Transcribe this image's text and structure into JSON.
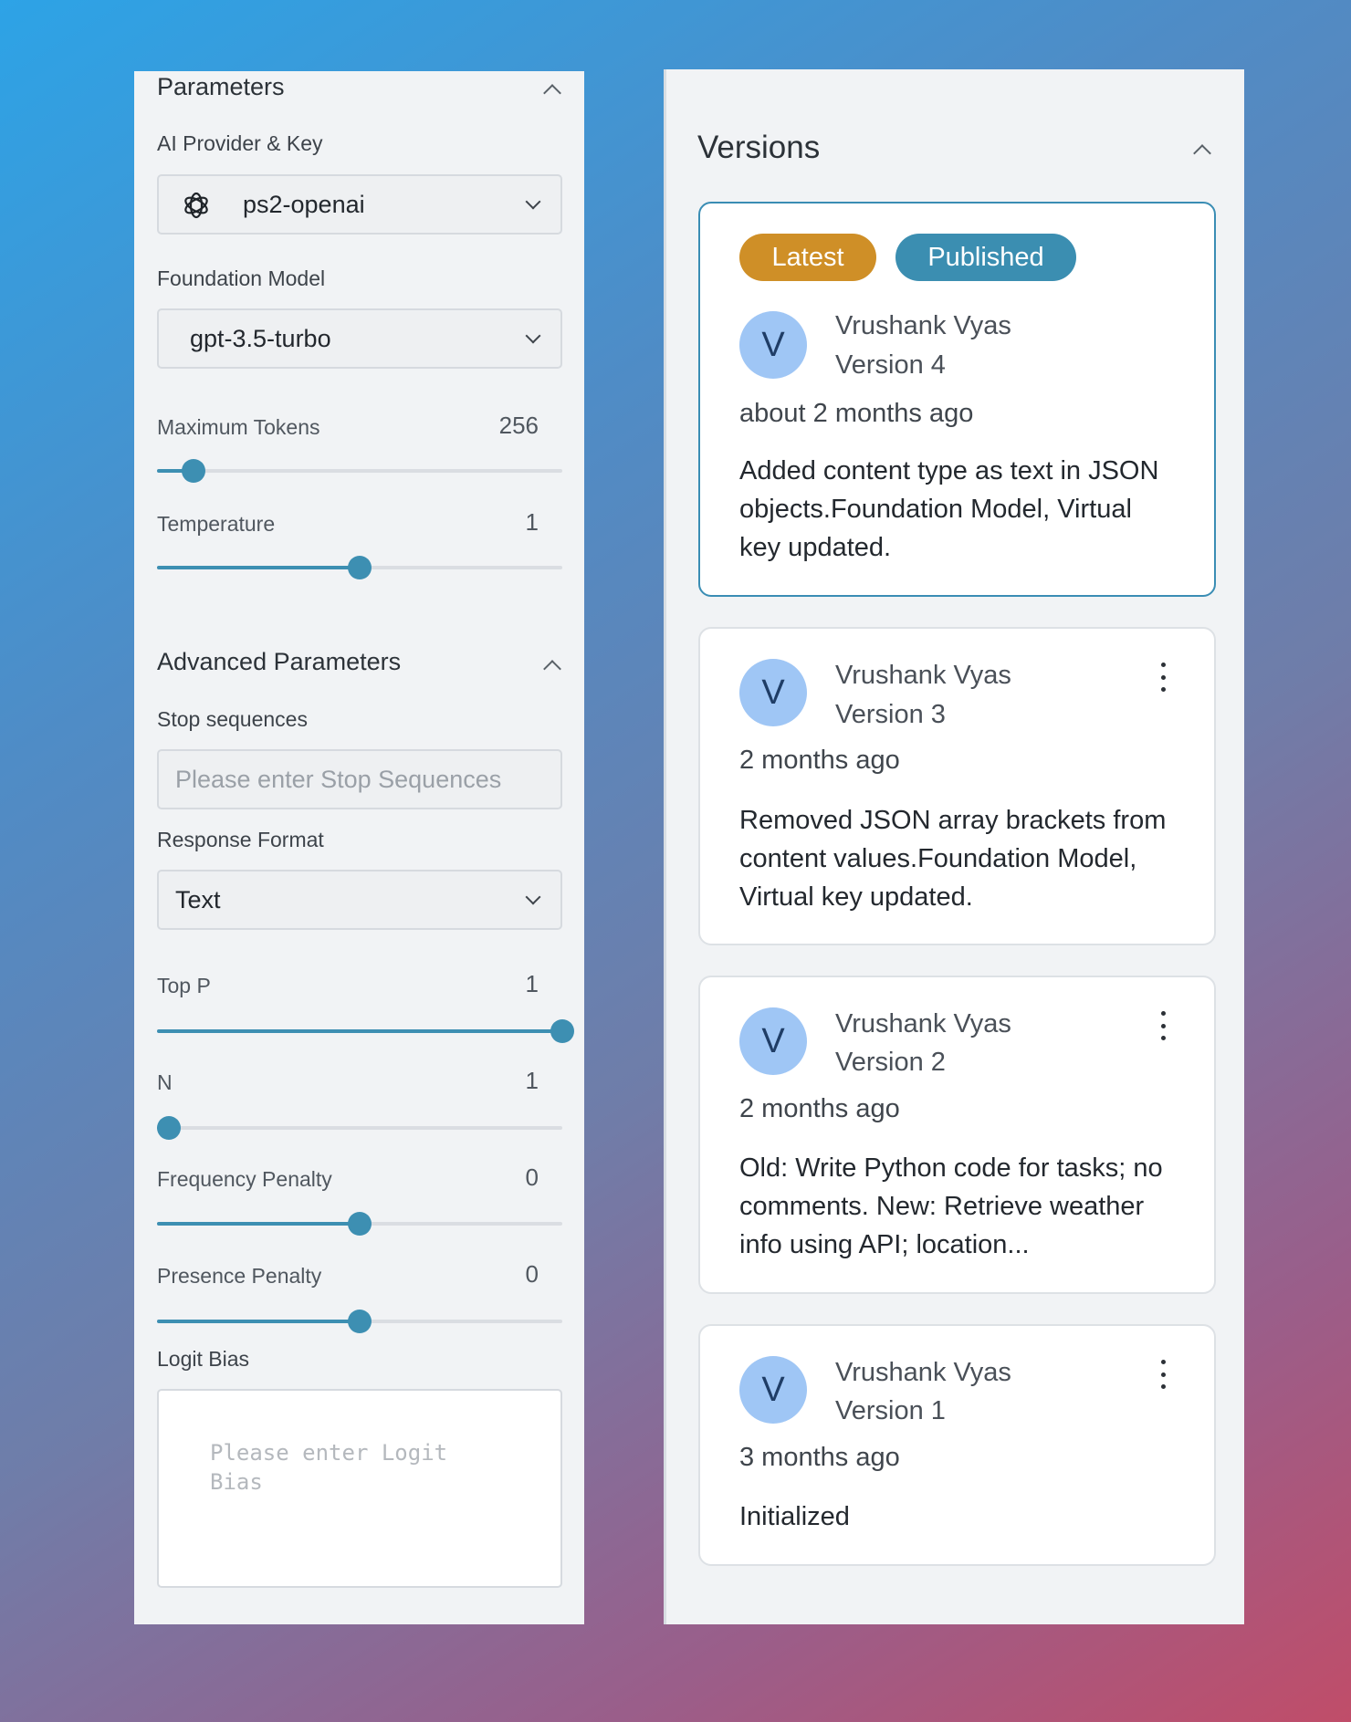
{
  "parameters": {
    "title": "Parameters",
    "provider_label": "AI Provider & Key",
    "provider_value": "ps2-openai",
    "provider_icon": "openai-logo-icon",
    "model_label": "Foundation Model",
    "model_value": "gpt-3.5-turbo",
    "max_tokens": {
      "label": "Maximum Tokens",
      "value": "256",
      "fraction": 0.09
    },
    "temperature": {
      "label": "Temperature",
      "value": "1",
      "fraction": 0.5
    }
  },
  "advanced": {
    "title": "Advanced Parameters",
    "stop_label": "Stop sequences",
    "stop_placeholder": "Please enter Stop Sequences",
    "format_label": "Response Format",
    "format_value": "Text",
    "top_p": {
      "label": "Top P",
      "value": "1",
      "fraction": 1.0
    },
    "n": {
      "label": "N",
      "value": "1",
      "fraction": 0.03
    },
    "frequency_penalty": {
      "label": "Frequency Penalty",
      "value": "0",
      "fraction": 0.5
    },
    "presence_penalty": {
      "label": "Presence Penalty",
      "value": "0",
      "fraction": 0.5
    },
    "logit_label": "Logit Bias",
    "logit_placeholder": "Please enter Logit Bias"
  },
  "versions": {
    "title": "Versions",
    "badge_latest": "Latest",
    "badge_published": "Published",
    "items": [
      {
        "avatar": "V",
        "author": "Vrushank Vyas",
        "version": "Version 4",
        "time": "about 2 months ago",
        "description": "Added content type as text in JSON objects.Foundation Model, Virtual key updated."
      },
      {
        "avatar": "V",
        "author": "Vrushank Vyas",
        "version": "Version 3",
        "time": "2 months ago",
        "description": "Removed JSON array brackets from content values.Foundation Model, Virtual key updated."
      },
      {
        "avatar": "V",
        "author": "Vrushank Vyas",
        "version": "Version 2",
        "time": "2 months ago",
        "description": "Old: Write Python code for tasks; no comments. New: Retrieve weather info using API; location..."
      },
      {
        "avatar": "V",
        "author": "Vrushank Vyas",
        "version": "Version 1",
        "time": "3 months ago",
        "description": "Initialized"
      }
    ]
  },
  "colors": {
    "accent": "#3d8fb2",
    "badge_latest": "#cf8f27",
    "badge_published": "#3b8eb1",
    "avatar_bg": "#9fc6f5"
  }
}
